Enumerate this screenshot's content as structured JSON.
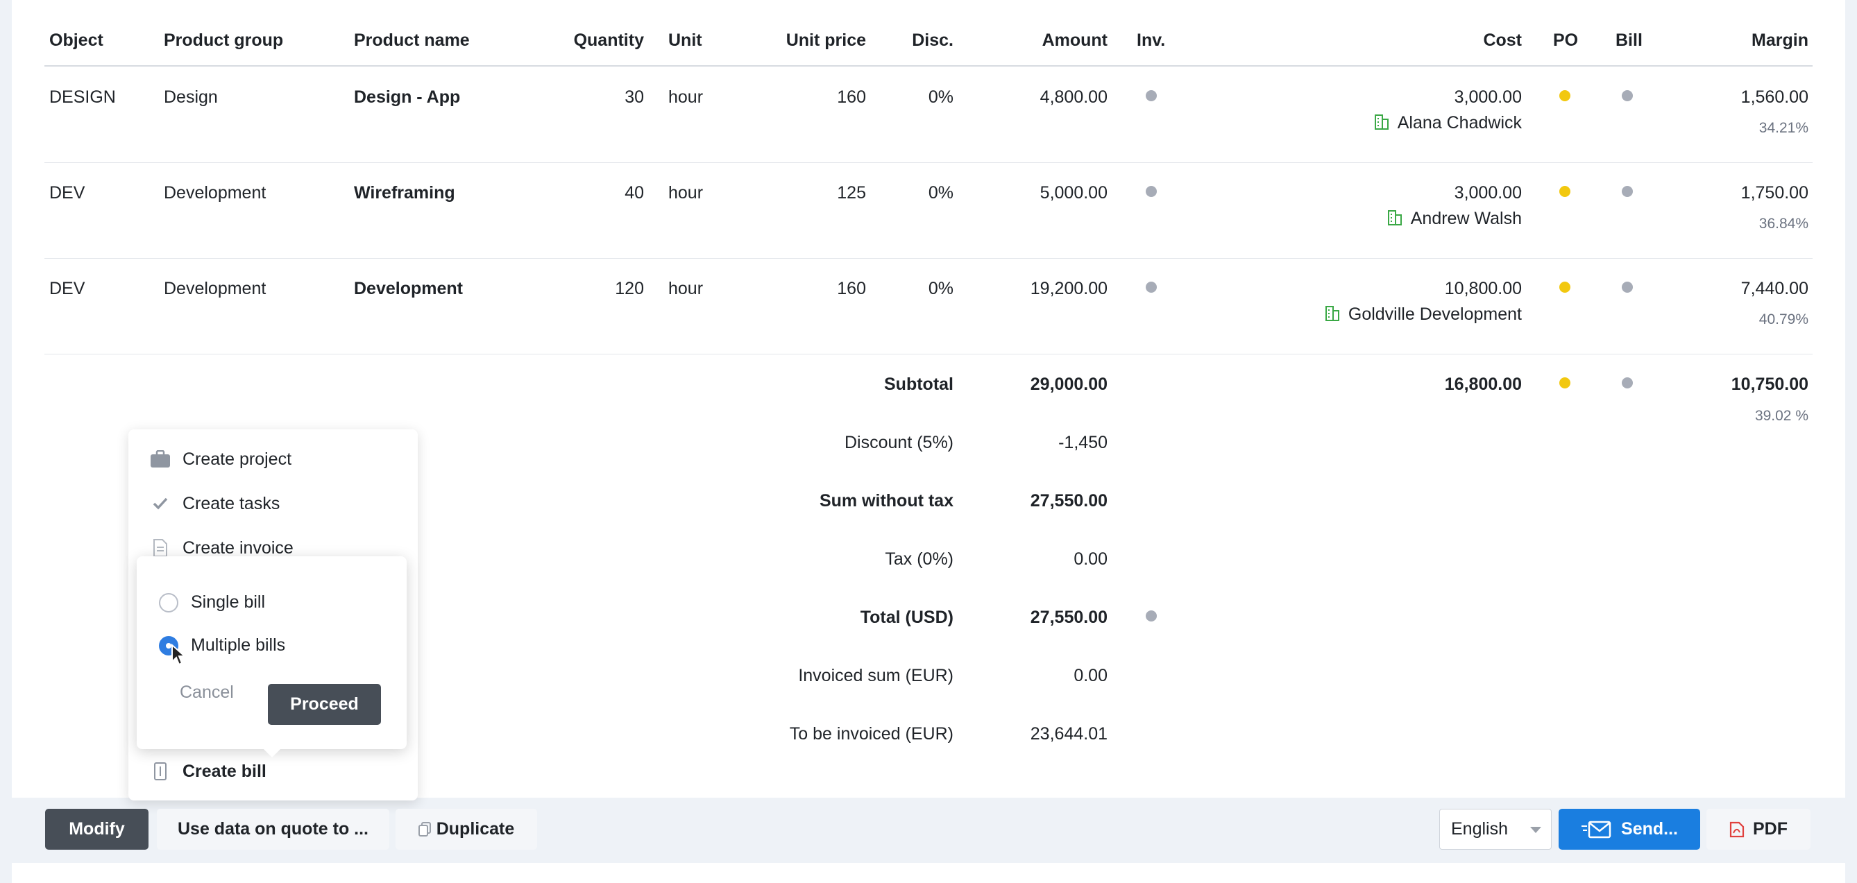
{
  "headers": {
    "object": "Object",
    "product_group": "Product group",
    "product_name": "Product name",
    "quantity": "Quantity",
    "unit": "Unit",
    "unit_price": "Unit price",
    "disc": "Disc.",
    "amount": "Amount",
    "inv": "Inv.",
    "cost": "Cost",
    "po": "PO",
    "bill": "Bill",
    "margin": "Margin"
  },
  "rows": [
    {
      "object": "DESIGN",
      "group": "Design",
      "name": "Design - App",
      "quantity": "30",
      "unit": "hour",
      "unit_price": "160",
      "disc": "0%",
      "amount": "4,800.00",
      "cost": "3,000.00",
      "vendor": "Alana Chadwick",
      "margin": "1,560.00",
      "margin_pct": "34.21%"
    },
    {
      "object": "DEV",
      "group": "Development",
      "name": "Wireframing",
      "quantity": "40",
      "unit": "hour",
      "unit_price": "125",
      "disc": "0%",
      "amount": "5,000.00",
      "cost": "3,000.00",
      "vendor": "Andrew Walsh",
      "margin": "1,750.00",
      "margin_pct": "36.84%"
    },
    {
      "object": "DEV",
      "group": "Development",
      "name": "Development",
      "quantity": "120",
      "unit": "hour",
      "unit_price": "160",
      "disc": "0%",
      "amount": "19,200.00",
      "cost": "10,800.00",
      "vendor": "Goldville Development",
      "margin": "7,440.00",
      "margin_pct": "40.79%"
    }
  ],
  "summary": {
    "subtotal_label": "Subtotal",
    "subtotal": "29,000.00",
    "cost_total": "16,800.00",
    "margin_total": "10,750.00",
    "margin_total_pct": "39.02 %",
    "discount_label": "Discount (5%)",
    "discount": "-1,450",
    "sum_wo_tax_label": "Sum without tax",
    "sum_wo_tax": "27,550.00",
    "tax_label": "Tax (0%)",
    "tax": "0.00",
    "total_label": "Total (USD)",
    "total": "27,550.00",
    "invoiced_label": "Invoiced sum (EUR)",
    "invoiced": "0.00",
    "to_invoice_label": "To be invoiced (EUR)",
    "to_invoice": "23,644.01"
  },
  "menu": {
    "create_project": "Create project",
    "create_tasks": "Create tasks",
    "create_invoice": "Create invoice",
    "create_bill": "Create bill"
  },
  "bill_popup": {
    "single_bill": "Single bill",
    "multiple_bills": "Multiple bills",
    "selected": "multiple",
    "cancel": "Cancel",
    "proceed": "Proceed"
  },
  "toolbar": {
    "modify": "Modify",
    "use_data": "Use data on quote to ...",
    "duplicate": "Duplicate",
    "language": "English",
    "send": "Send...",
    "pdf": "PDF"
  },
  "colors": {
    "accent_blue": "#1a7ee0",
    "dark_button": "#474e57",
    "po_yellow": "#f2c80f",
    "status_gray": "#a7acb7",
    "vendor_green": "#3aa845",
    "pdf_red": "#e0413e"
  }
}
